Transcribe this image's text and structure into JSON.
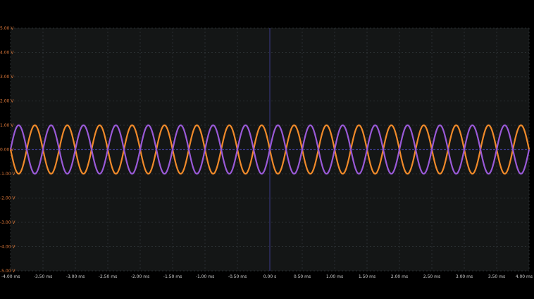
{
  "y_axis": {
    "ticks": [
      {
        "value": 5,
        "label": "5.00 V"
      },
      {
        "value": 4,
        "label": "4.00 V"
      },
      {
        "value": 3,
        "label": "3.00 V"
      },
      {
        "value": 2,
        "label": "2.00 V"
      },
      {
        "value": 1,
        "label": "1.00 V"
      },
      {
        "value": 0,
        "label": "0.00 V"
      },
      {
        "value": -1,
        "label": "-1.00 V"
      },
      {
        "value": -2,
        "label": "-2.00 V"
      },
      {
        "value": -3,
        "label": "-3.00 V"
      },
      {
        "value": -4,
        "label": "-4.00 V"
      },
      {
        "value": -5,
        "label": "-5.00 V"
      }
    ],
    "range": [
      -5,
      5
    ],
    "unit": "V",
    "label_color": "#e07a3a"
  },
  "x_axis": {
    "ticks": [
      {
        "value": -4.0,
        "label": "-4.00 ms"
      },
      {
        "value": -3.5,
        "label": "-3.50 ms"
      },
      {
        "value": -3.0,
        "label": "-3.00 ms"
      },
      {
        "value": -2.5,
        "label": "-2.50 ms"
      },
      {
        "value": -2.0,
        "label": "-2.00 ms"
      },
      {
        "value": -1.5,
        "label": "-1.50 ms"
      },
      {
        "value": -1.0,
        "label": "-1.00 ms"
      },
      {
        "value": -0.5,
        "label": "-0.50 ms"
      },
      {
        "value": 0.0,
        "label": "0.00 s"
      },
      {
        "value": 0.5,
        "label": "0.50 ms"
      },
      {
        "value": 1.0,
        "label": "1.00 ms"
      },
      {
        "value": 1.5,
        "label": "1.50 ms"
      },
      {
        "value": 2.0,
        "label": "2.00 ms"
      },
      {
        "value": 2.5,
        "label": "2.50 ms"
      },
      {
        "value": 3.0,
        "label": "3.00 ms"
      },
      {
        "value": 3.5,
        "label": "3.50 ms"
      },
      {
        "value": 4.0,
        "label": "4.00 ms"
      }
    ],
    "range": [
      -4,
      4
    ],
    "unit": "ms",
    "label_color": "#cfcfcf"
  },
  "grid": true,
  "colors": {
    "background": "#000000",
    "plot_background": "#141616",
    "grid": "#2a2f31",
    "center_line": "#3b3a8a",
    "channel_a": "#f08a2a",
    "channel_b": "#9a5ad8"
  },
  "chart_data": {
    "type": "line",
    "ylim": [
      -5,
      5
    ],
    "xlim": [
      -4,
      4
    ],
    "series": [
      {
        "color": "#f08a2a",
        "waveform": "sine",
        "amplitude_v": 1.0,
        "frequency_khz": 2.0,
        "phase_deg": 180
      },
      {
        "color": "#9a5ad8",
        "waveform": "sine",
        "amplitude_v": 1.0,
        "frequency_khz": 2.0,
        "phase_deg": 0
      }
    ]
  }
}
